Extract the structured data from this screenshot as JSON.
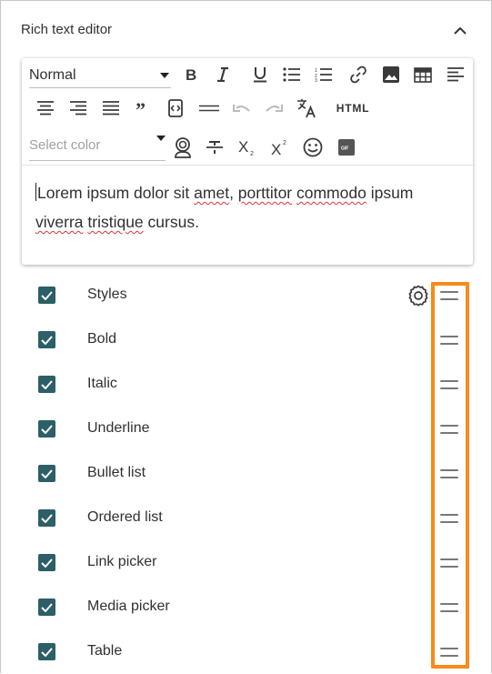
{
  "panel": {
    "title": "Rich text editor"
  },
  "toolbar": {
    "format_value": "Normal",
    "color_placeholder": "Select color",
    "html_label": "HTML",
    "icons": [
      "bold-icon",
      "italic-icon",
      "underline-icon",
      "bullet-list-icon",
      "ordered-list-icon",
      "link-icon",
      "image-icon",
      "table-icon",
      "align-left-icon",
      "align-center-icon",
      "align-right-icon",
      "align-justify-icon",
      "blockquote-icon",
      "code-block-icon",
      "horizontal-rule-icon",
      "undo-icon",
      "redo-icon",
      "translate-icon",
      "html-icon",
      "color-picker-icon",
      "format-paint-icon",
      "strikethrough-icon",
      "subscript-icon",
      "superscript-icon",
      "emoji-icon",
      "gif-icon"
    ]
  },
  "editor": {
    "w1": "Lorem ipsum dolor sit ",
    "w2": "amet",
    "w3": ", ",
    "w4": "porttitor",
    "w5": " ",
    "w6": "commodo",
    "w7": " ipsum",
    "w8": "viverra",
    "w9": " ",
    "w10": "tristique",
    "w11": " cursus."
  },
  "items": [
    {
      "label": "Styles",
      "checked": true,
      "has_settings": true
    },
    {
      "label": "Bold",
      "checked": true
    },
    {
      "label": "Italic",
      "checked": true
    },
    {
      "label": "Underline",
      "checked": true
    },
    {
      "label": "Bullet list",
      "checked": true
    },
    {
      "label": "Ordered list",
      "checked": true
    },
    {
      "label": "Link picker",
      "checked": true
    },
    {
      "label": "Media picker",
      "checked": true
    },
    {
      "label": "Table",
      "checked": true
    }
  ],
  "colors": {
    "checkbox": "#2c5f68",
    "highlight": "#f78a1a"
  }
}
